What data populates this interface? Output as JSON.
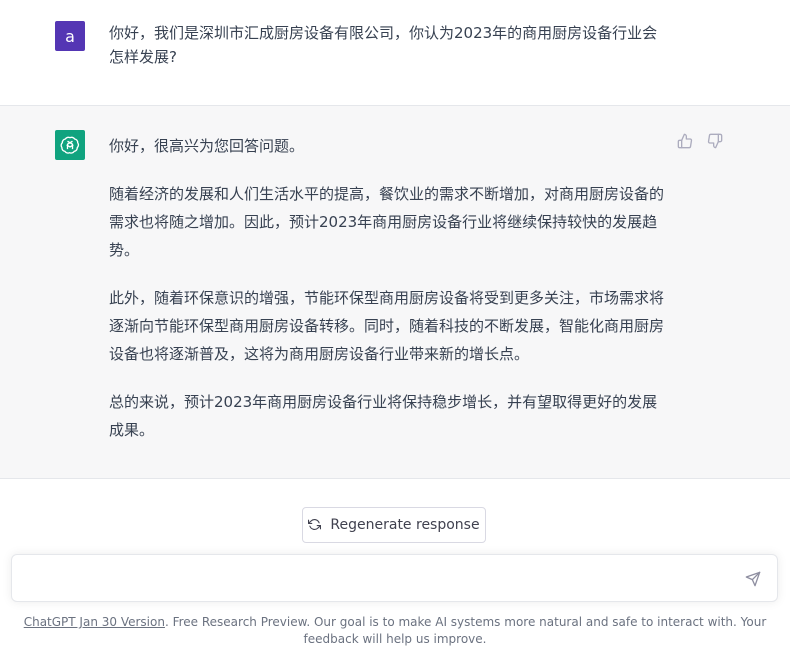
{
  "user_message": {
    "avatar_letter": "a",
    "text": "你好，我们是深圳市汇成厨房设备有限公司，你认为2023年的商用厨房设备行业会怎样发展?"
  },
  "assistant_message": {
    "paragraphs": [
      "你好，很高兴为您回答问题。",
      "随着经济的发展和人们生活水平的提高，餐饮业的需求不断增加，对商用厨房设备的需求也将随之增加。因此，预计2023年商用厨房设备行业将继续保持较快的发展趋势。",
      "此外，随着环保意识的增强，节能环保型商用厨房设备将受到更多关注，市场需求将逐渐向节能环保型商用厨房设备转移。同时，随着科技的不断发展，智能化商用厨房设备也将逐渐普及，这将为商用厨房设备行业带来新的增长点。",
      "总的来说，预计2023年商用厨房设备行业将保持稳步增长，并有望取得更好的发展成果。"
    ]
  },
  "regenerate": {
    "label": "Regenerate response",
    "icon": "refresh-icon"
  },
  "composer": {
    "value": "",
    "send_icon": "send-icon"
  },
  "footer": {
    "link_text": "ChatGPT Jan 30 Version",
    "text": ". Free Research Preview. Our goal is to make AI systems more natural and safe to interact with. Your feedback will help us improve."
  },
  "colors": {
    "user_avatar": "#5436b4",
    "gpt_avatar": "#10a37f",
    "assistant_bg": "#f7f7f8"
  }
}
